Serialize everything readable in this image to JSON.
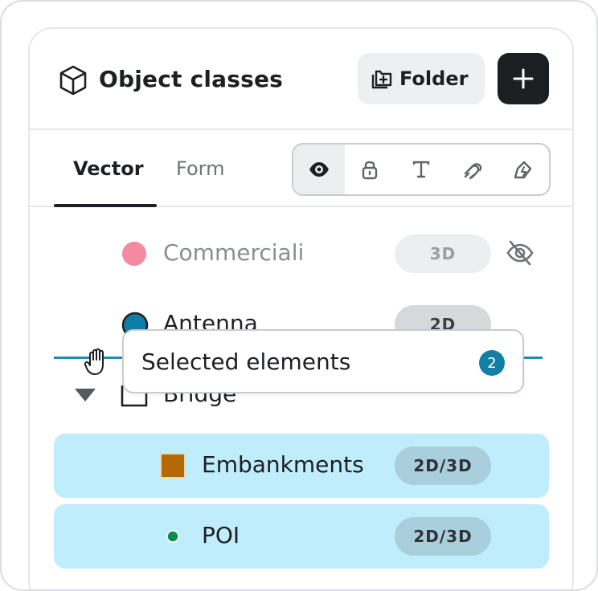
{
  "header": {
    "title": "Object classes",
    "folder_label": "Folder",
    "icons": {
      "title": "cube-icon",
      "folder": "folder-plus-icon",
      "add": "plus-icon"
    }
  },
  "tabs": [
    {
      "label": "Vector",
      "active": true
    },
    {
      "label": "Form",
      "active": false
    }
  ],
  "toolbar": {
    "icons": [
      "eye-icon",
      "lock-icon",
      "text-icon",
      "magnet-icon",
      "draw-icon"
    ],
    "active_index": 0
  },
  "classes": [
    {
      "name": "Commerciali",
      "badge": "3D",
      "color": "#f38aa0",
      "shape": "circle",
      "hidden": true
    },
    {
      "name": "Antenna",
      "badge": "2D",
      "color": "#0f7ea6",
      "shape": "circle",
      "hidden": false
    },
    {
      "name": "Bridge",
      "type": "folder",
      "expanded": true
    },
    {
      "name": "Embankments",
      "badge": "2D/3D",
      "color": "#b46a00",
      "shape": "square",
      "selected": true
    },
    {
      "name": "POI",
      "badge": "2D/3D",
      "color": "#0f8a50",
      "shape": "dot",
      "selected": true
    }
  ],
  "tooltip": {
    "text": "Selected elements",
    "count": "2"
  },
  "colors": {
    "accent": "#137fa6",
    "selection": "#bfedfb",
    "dark_button": "#1c1f21"
  }
}
